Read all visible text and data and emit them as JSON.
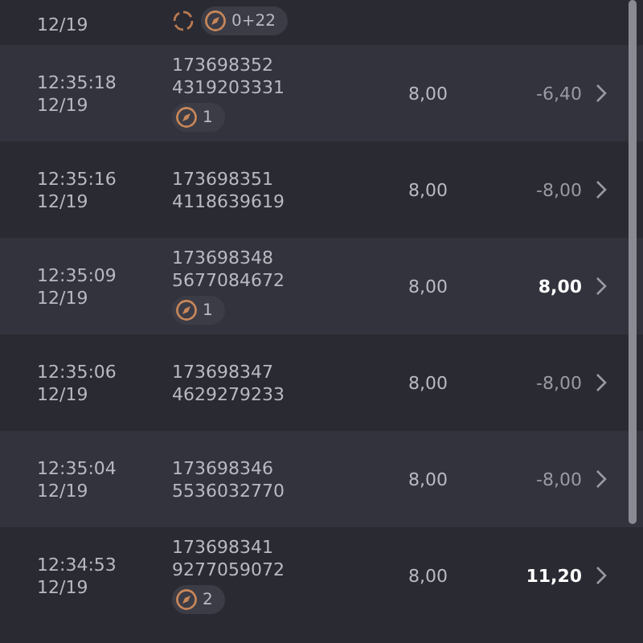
{
  "rows": [
    {
      "date": "12/19",
      "ids": [],
      "badges": [
        {
          "kind": "loading"
        },
        {
          "kind": "count",
          "text": "0+22"
        }
      ]
    },
    {
      "time": "12:35:18",
      "date": "12/19",
      "ids": [
        "173698352",
        "4319203331"
      ],
      "value": "8,00",
      "amount": "-6,40",
      "emphasis": false,
      "badges": [
        {
          "kind": "count",
          "text": "1"
        }
      ]
    },
    {
      "time": "12:35:16",
      "date": "12/19",
      "ids": [
        "173698351",
        "4118639619"
      ],
      "value": "8,00",
      "amount": "-8,00",
      "emphasis": false,
      "badges": []
    },
    {
      "time": "12:35:09",
      "date": "12/19",
      "ids": [
        "173698348",
        "5677084672"
      ],
      "value": "8,00",
      "amount": "8,00",
      "emphasis": true,
      "badges": [
        {
          "kind": "count",
          "text": "1"
        }
      ]
    },
    {
      "time": "12:35:06",
      "date": "12/19",
      "ids": [
        "173698347",
        "4629279233"
      ],
      "value": "8,00",
      "amount": "-8,00",
      "emphasis": false,
      "badges": []
    },
    {
      "time": "12:35:04",
      "date": "12/19",
      "ids": [
        "173698346",
        "5536032770"
      ],
      "value": "8,00",
      "amount": "-8,00",
      "emphasis": false,
      "badges": []
    },
    {
      "time": "12:34:53",
      "date": "12/19",
      "ids": [
        "173698341",
        "9277059072"
      ],
      "value": "8,00",
      "amount": "11,20",
      "emphasis": true,
      "badges": [
        {
          "kind": "count",
          "text": "2"
        }
      ]
    }
  ]
}
